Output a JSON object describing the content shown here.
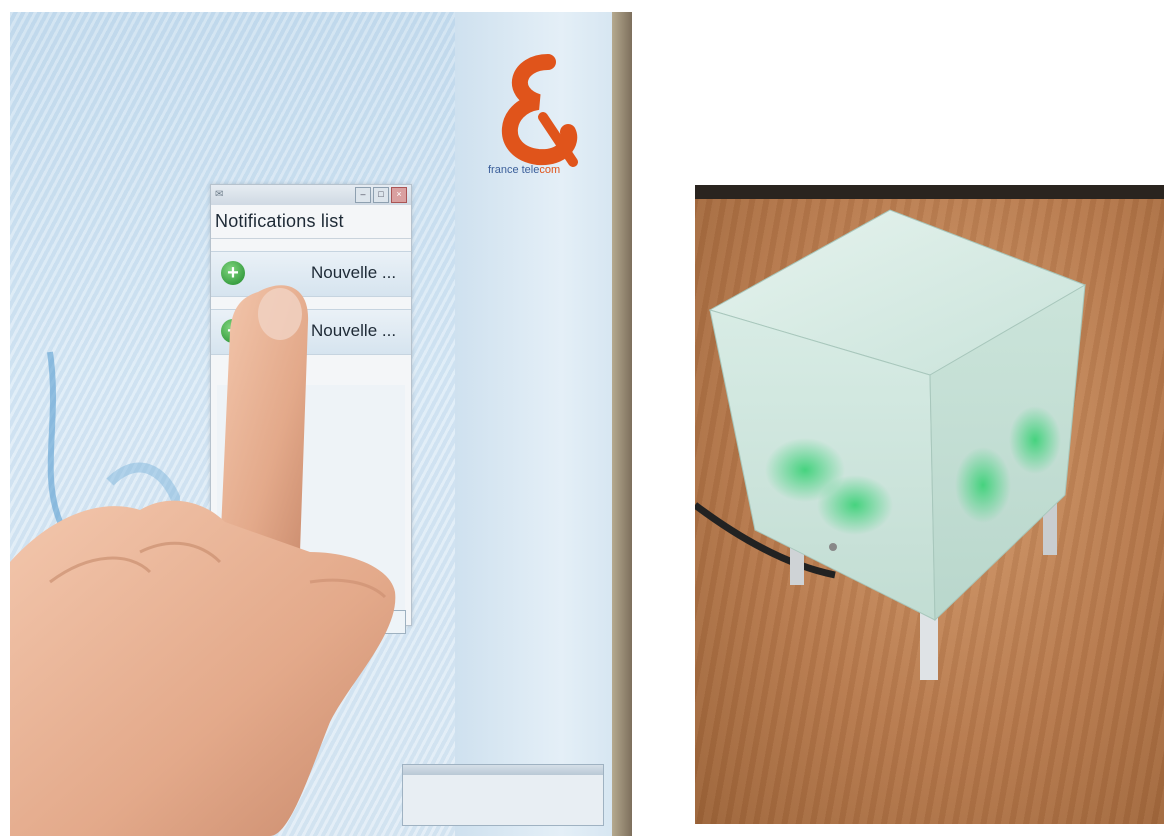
{
  "left_photo": {
    "notification_window": {
      "title": "Notifications list",
      "items": [
        {
          "label": "Nouvelle ..."
        },
        {
          "label": "Nouvelle ..."
        }
      ]
    },
    "logo": {
      "brand_text_part1": "france tele",
      "brand_text_part2": "com"
    }
  },
  "right_photo": {},
  "colors": {
    "screen": "#d5e6f3",
    "accent_orange": "#e0541b",
    "cube_glow": "#3fd27a",
    "table": "#b97d52"
  }
}
